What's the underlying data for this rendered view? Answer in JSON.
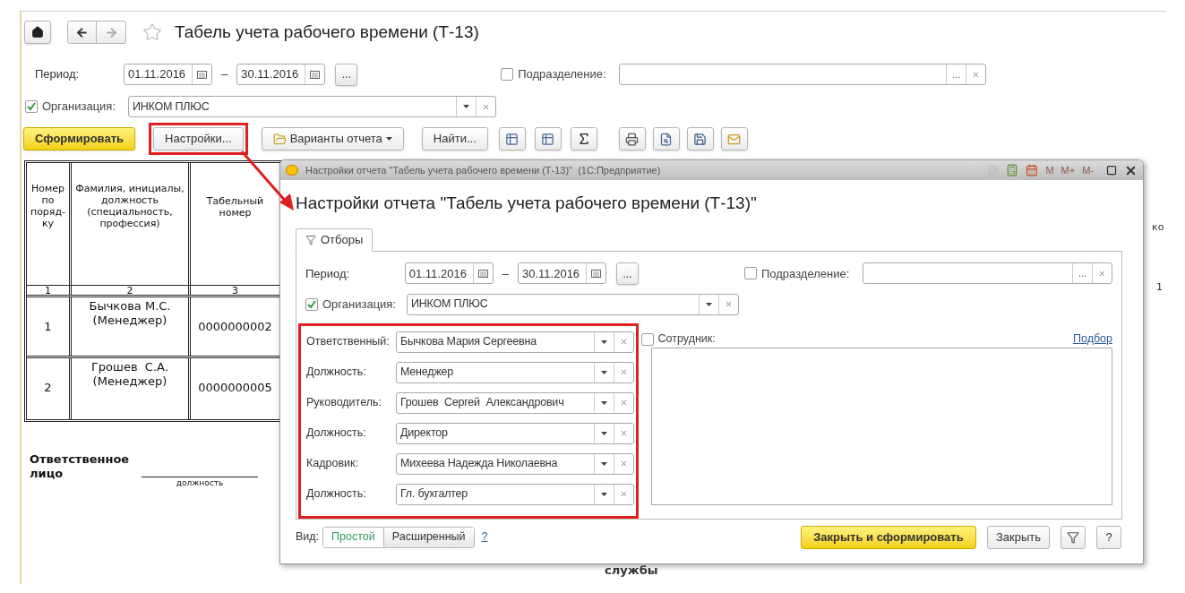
{
  "window": {
    "title": "Табель учета рабочего времени (Т-13)"
  },
  "filters": {
    "period": {
      "label": "Период:",
      "from": "01.11.2016",
      "dash": "–",
      "to": "30.11.2016",
      "select": "..."
    },
    "subdivision": {
      "label": "Подразделение:",
      "checked": false,
      "select": "..."
    },
    "organization": {
      "label": "Организация:",
      "checked": true,
      "value": "ИНКОМ ПЛЮС"
    }
  },
  "toolbar": [
    {
      "label": "Сформировать",
      "kind": "primary",
      "highlighted": false
    },
    {
      "label": "Настройки...",
      "kind": "plain",
      "highlighted": true
    },
    {
      "label": "Варианты отчета",
      "kind": "dropdown",
      "highlighted": false
    },
    {
      "label": "Найти...",
      "kind": "plain",
      "highlighted": false
    }
  ],
  "report": {
    "columns": [
      {
        "header": "Номер\nпо\nпоряд-\nку",
        "number": "1"
      },
      {
        "header": "Фамилия, инициалы,\nдолжность\n(специальность,\nпрофессия)",
        "number": "2"
      },
      {
        "header": "Табельный\nномер",
        "number": "3"
      }
    ],
    "rows": [
      {
        "cells": [
          "1",
          "Бычкова М.С.\n(Менеджер)",
          "0000000002"
        ]
      },
      {
        "cells": [
          "2",
          "Грошев  С.А.\n(Менеджер)",
          "0000000005"
        ]
      }
    ],
    "signature": {
      "label": "Ответственное\nлицо",
      "caption": "должность"
    },
    "hidden_column_header": "ко",
    "hidden_column_number": "1",
    "footer_fragment": "службы"
  },
  "dialog": {
    "caption": "Настройки отчета \"Табель учета рабочего времени (Т-13)\"  (1С:Предприятие)",
    "memory_buttons": [
      "M",
      "M+",
      "M-"
    ],
    "title": "Настройки отчета \"Табель учета рабочего времени (Т-13)\"",
    "tabs": [
      {
        "label": "Отборы",
        "selected": true
      }
    ],
    "period": {
      "label": "Период:",
      "from": "01.11.2016",
      "dash": "–",
      "to": "30.11.2016",
      "select": "..."
    },
    "subdivision": {
      "label": "Подразделение:",
      "checked": false,
      "select": "..."
    },
    "organization": {
      "label": "Организация:",
      "checked": true,
      "value": "ИНКОМ ПЛЮС"
    },
    "signers": [
      {
        "label": "Ответственный:",
        "value": "Бычкова Мария Сергеевна"
      },
      {
        "label": "Должность:",
        "value": "Менеджер"
      },
      {
        "label": "Руководитель:",
        "value": "Грошев  Сергей  Александрович"
      },
      {
        "label": "Должность:",
        "value": "Директор"
      },
      {
        "label": "Кадровик:",
        "value": "Михеева Надежда Николаевна"
      },
      {
        "label": "Должность:",
        "value": "Гл. бухгалтер"
      }
    ],
    "employee": {
      "label": "Сотрудник:",
      "checked": false
    },
    "pick_link": "Подбор",
    "view": {
      "label": "Вид:",
      "options": [
        {
          "label": "Простой",
          "selected": true
        },
        {
          "label": "Расширенный",
          "selected": false
        }
      ],
      "help": "?"
    },
    "buttons": [
      {
        "label": "Закрыть и сформировать",
        "kind": "primary"
      },
      {
        "label": "Закрыть",
        "kind": "plain"
      },
      {
        "kind": "filter"
      },
      {
        "label": "?",
        "kind": "plain"
      }
    ]
  }
}
